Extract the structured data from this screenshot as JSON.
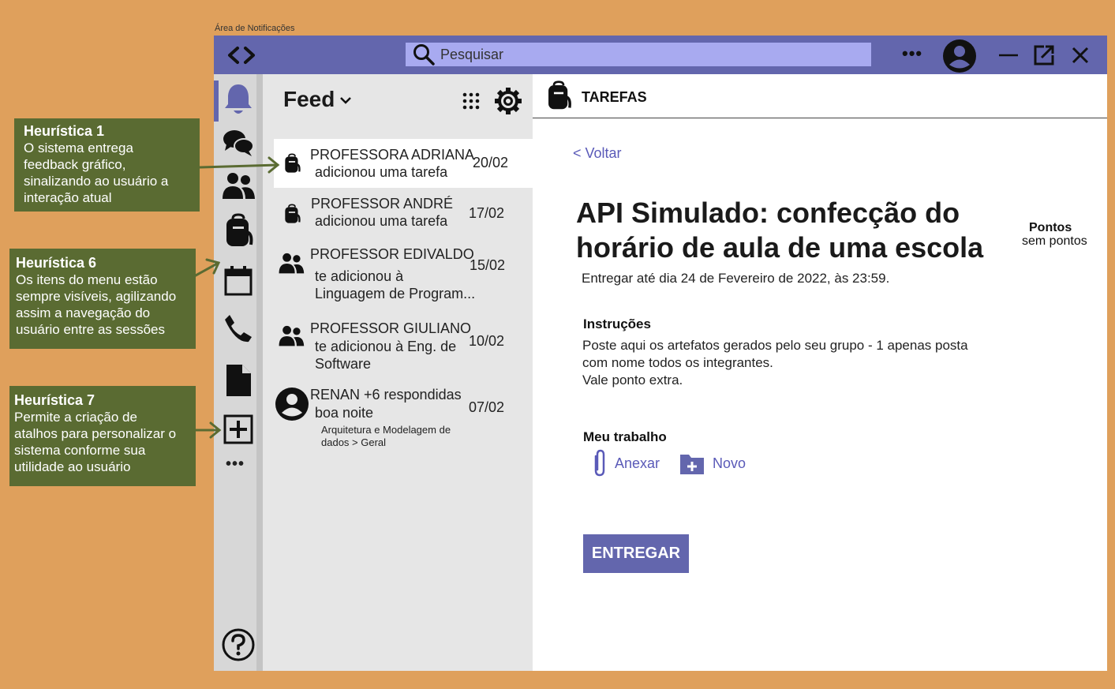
{
  "frame_title": "Área de Notificações",
  "colors": {
    "accent": "#6366ad",
    "search_bg": "#a8aaf0",
    "background": "#dfa05c",
    "note_bg": "#5a6b32",
    "link": "#5a5ab8"
  },
  "topbar": {
    "search_placeholder": "Pesquisar",
    "more_label": "•••",
    "icons": [
      "back-forward-icon",
      "search-icon",
      "more-icon",
      "avatar-icon",
      "minimize-icon",
      "popout-icon",
      "close-icon"
    ]
  },
  "rail": {
    "items": [
      {
        "name": "notifications",
        "icon": "bell-icon",
        "active": true
      },
      {
        "name": "chat",
        "icon": "chat-icon"
      },
      {
        "name": "teams",
        "icon": "people-icon"
      },
      {
        "name": "tasks",
        "icon": "backpack-icon"
      },
      {
        "name": "calendar",
        "icon": "calendar-icon"
      },
      {
        "name": "calls",
        "icon": "phone-icon"
      },
      {
        "name": "files",
        "icon": "file-icon"
      },
      {
        "name": "add",
        "icon": "plus-box-icon"
      }
    ],
    "more_label": "•••",
    "help_icon": "help-icon"
  },
  "feed": {
    "title": "Feed",
    "items": [
      {
        "icon": "backpack-icon",
        "name": "PROFESSORA ADRIANA",
        "sub": "adicionou uma tarefa",
        "date": "20/02",
        "active": true
      },
      {
        "icon": "backpack-icon",
        "name": "PROFESSOR ANDRÉ",
        "sub": "adicionou uma tarefa",
        "date": "17/02"
      },
      {
        "icon": "people-icon",
        "name": "PROFESSOR EDIVALDO",
        "sub_line1": "te adicionou à",
        "sub_line2": "Linguagem de Program...",
        "date": "15/02"
      },
      {
        "icon": "people-icon",
        "name": "PROFESSOR GIULIANO",
        "sub_line1": "te adicionou à Eng. de",
        "sub_line2": "Software",
        "date": "10/02"
      },
      {
        "icon": "avatar-icon",
        "name": "RENAN +6 respondidas",
        "sub": "boa noite",
        "meta_line1": "Arquitetura e Modelagem de",
        "meta_line2": "dados > Geral",
        "date": "07/02"
      }
    ]
  },
  "detail": {
    "tab_label": "TAREFAS",
    "back_label": "< Voltar",
    "title_line1": "API Simulado: confecção do",
    "title_line2": "horário de aula de uma escola",
    "points_label": "Pontos",
    "points_value": "sem pontos",
    "due": "Entregar até dia 24 de Fevereiro de 2022, às 23:59.",
    "instructions_label": "Instruções",
    "instructions_line1": "Poste aqui os artefatos gerados pelo seu grupo  - 1 apenas posta",
    "instructions_line2": "com nome todos os integrantes.",
    "instructions_line3": "Vale ponto extra.",
    "my_work_label": "Meu trabalho",
    "attach_label": "Anexar",
    "new_label": "Novo",
    "submit_label": "ENTREGAR"
  },
  "notes": [
    {
      "title": "Heurística 1",
      "lines": [
        "O sistema entrega",
        "feedback gráfico,",
        "sinalizando ao usuário a",
        "interação atual"
      ]
    },
    {
      "title": "Heurística 6",
      "lines": [
        " Os itens do menu estão",
        "sempre visíveis, agilizando",
        "assim a navegação do",
        "usuário entre as sessões"
      ]
    },
    {
      "title": "Heurística 7",
      "lines": [
        "Permite a criação de",
        "atalhos para personalizar o",
        "sistema conforme sua",
        "utilidade ao usuário"
      ]
    }
  ]
}
